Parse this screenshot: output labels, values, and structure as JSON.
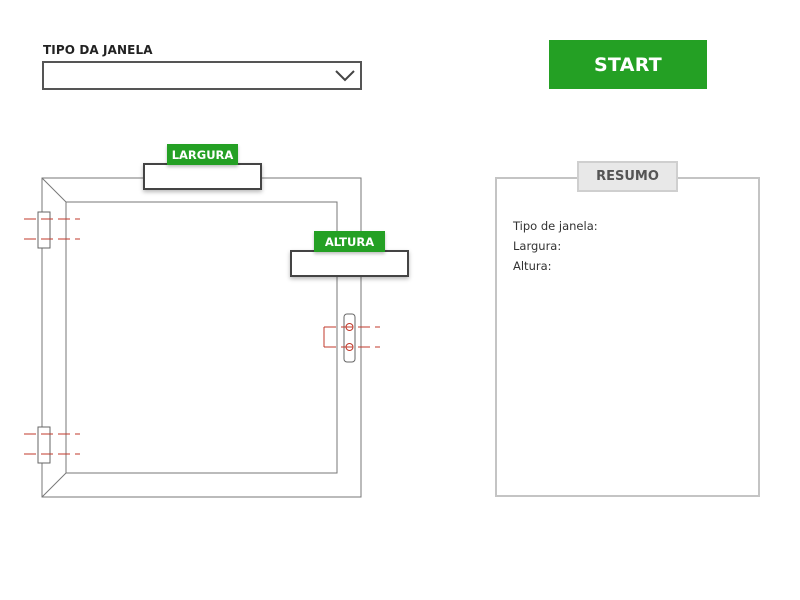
{
  "window_type": {
    "label": "TIPO DA JANELA",
    "selected_value": ""
  },
  "start_button": {
    "label": "START"
  },
  "dimensions": {
    "width_label": "LARGURA",
    "width_value": "",
    "height_label": "ALTURA",
    "height_value": ""
  },
  "summary": {
    "title": "RESUMO",
    "lines": [
      "Tipo de janela:",
      "Largura:",
      "Altura:"
    ]
  },
  "colors": {
    "accent": "#24a024",
    "hinge_marks": "#c0392b",
    "frame": "#666666"
  }
}
